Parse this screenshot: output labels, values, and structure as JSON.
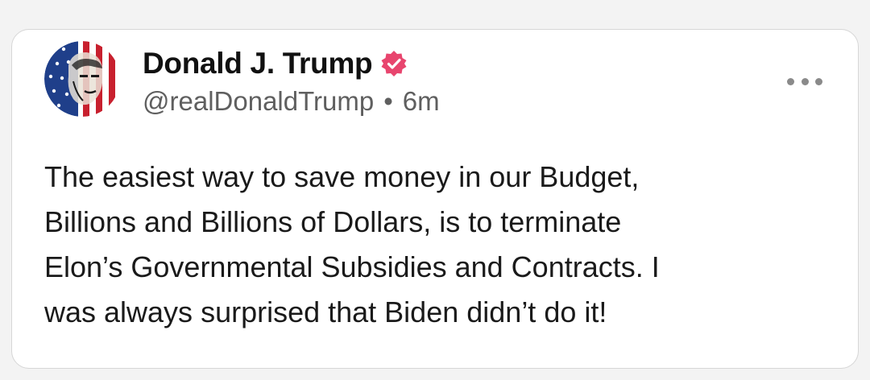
{
  "post": {
    "author": {
      "display_name": "Donald J. Trump",
      "handle": "@realDonaldTrump",
      "verified_icon": "verified-badge-icon",
      "avatar_icon": "flag-portrait-avatar"
    },
    "separator": "•",
    "time_ago": "6m",
    "more_icon": "more-options-icon",
    "text_lines": [
      "The easiest way to save money in our Budget,",
      "Billions and Billions of Dollars, is to terminate",
      "Elon’s Governmental Subsidies and Contracts. I",
      "was always surprised that Biden didn’t do it!"
    ]
  },
  "colors": {
    "badge": "#e8456e",
    "handle_text": "#5f5f5f",
    "body_text": "#1a1a1a",
    "card_border": "#d6d6d6"
  }
}
